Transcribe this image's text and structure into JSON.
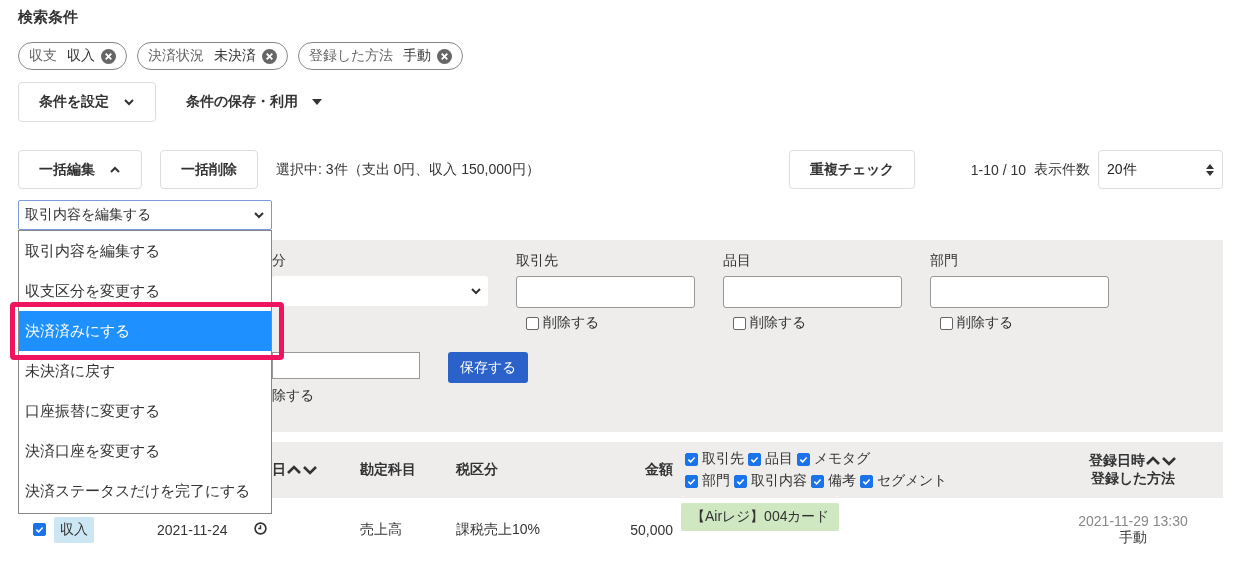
{
  "heading": "検索条件",
  "filter_chips": [
    {
      "key": "収支",
      "value": "収入"
    },
    {
      "key": "決済状況",
      "value": "未決済"
    },
    {
      "key": "登録した方法",
      "value": "手動"
    }
  ],
  "condition_buttons": {
    "set": "条件を設定",
    "save": "条件の保存・利用"
  },
  "toolbar": {
    "bulk_edit": {
      "label": "一括編集",
      "expanded": true
    },
    "bulk_delete": "一括削除",
    "selection_summary": "選択中: 3件（支出 0円、収入 150,000円）",
    "duplicate_check": "重複チェック",
    "range": "1-10 / 10",
    "per_page_label": "表示件数",
    "per_page": "20件"
  },
  "action_select": {
    "value": "取引内容を編集する",
    "expanded": true,
    "options": [
      {
        "label": "取引内容を編集する",
        "highlighted": false,
        "framed": false
      },
      {
        "label": "収支区分を変更する",
        "highlighted": false,
        "framed": false
      },
      {
        "label": "決済済みにする",
        "highlighted": true,
        "framed": true
      },
      {
        "label": "未決済に戻す",
        "highlighted": false,
        "framed": false
      },
      {
        "label": "口座振替に変更する",
        "highlighted": false,
        "framed": false
      },
      {
        "label": "決済口座を変更する",
        "highlighted": false,
        "framed": false
      },
      {
        "label": "決済ステータスだけを完了にする",
        "highlighted": false,
        "framed": false
      }
    ]
  },
  "edit_panel": {
    "fields": [
      {
        "label": "分",
        "kind": "select"
      },
      {
        "label": "取引先",
        "kind": "text",
        "delete_option": {
          "label": "削除する",
          "checked": false
        }
      },
      {
        "label": "品目",
        "kind": "text",
        "delete_option": {
          "label": "削除する",
          "checked": false
        }
      },
      {
        "label": "部門",
        "kind": "text",
        "delete_option": {
          "label": "削除する",
          "checked": false
        }
      }
    ],
    "delete_fragment": "除する",
    "save_button": "保存する"
  },
  "table": {
    "headers": {
      "date": "日",
      "account": "勘定科目",
      "tax": "税区分",
      "amount": "金額",
      "registered": "登録日時",
      "method": "登録した方法"
    },
    "column_options": [
      [
        {
          "label": "取引先",
          "checked": true
        },
        {
          "label": "品目",
          "checked": true
        },
        {
          "label": "メモタグ",
          "checked": true
        }
      ],
      [
        {
          "label": "部門",
          "checked": true
        },
        {
          "label": "取引内容",
          "checked": true
        },
        {
          "label": "備考",
          "checked": true
        },
        {
          "label": "セグメント",
          "checked": true
        }
      ]
    ],
    "rows": [
      {
        "checked": true,
        "type": "収入",
        "date": "2021-11-24",
        "account": "売上高",
        "tax": "課税売上10%",
        "amount": "50,000",
        "tag": "【Airレジ】004カード",
        "registered_at": "2021-11-29 13:30",
        "method": "手動"
      }
    ]
  }
}
